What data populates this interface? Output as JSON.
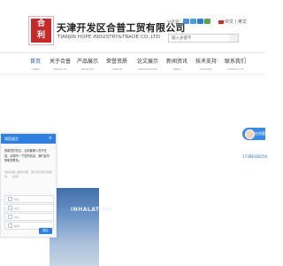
{
  "header": {
    "logo_text": "合\n利",
    "company_cn": "天津开发区合普工贸有限公司",
    "company_en": "TIANJIN HOPE INDUSTRY&TRADE CO.,LTD",
    "share_label": "分享到：",
    "language": "中文 | 英文",
    "search_placeholder": "输入关键字"
  },
  "nav": [
    {
      "cn": "首页",
      "en": "HOME"
    },
    {
      "cn": "关于合普",
      "en": "ABOUT US"
    },
    {
      "cn": "产品展示",
      "en": "PRODUCT"
    },
    {
      "cn": "荣誉资质",
      "en": "HONOR"
    },
    {
      "cn": "论文展示",
      "en": "DISSERTATION"
    },
    {
      "cn": "新闻资讯",
      "en": "NEWS"
    },
    {
      "cn": "技术支持",
      "en": "SUPPORT"
    },
    {
      "cn": "联系我们",
      "en": "CONTACT US"
    }
  ],
  "side": {
    "avatar_label": "在线客服",
    "phone": "17368166256"
  },
  "banner": {
    "photo_text": "INHALATION"
  },
  "chat": {
    "title": "请您留言",
    "close": "×",
    "message": "感谢您的关注，当前客服人员不在线，请填写一下您的信息，我们会尽快和您联系。",
    "placeholder": "请在此输入留言内容，我们会尽快与您联系。（必填）",
    "fields": [
      "姓名",
      "电话",
      "地址",
      "邮箱"
    ],
    "submit": "提交"
  }
}
